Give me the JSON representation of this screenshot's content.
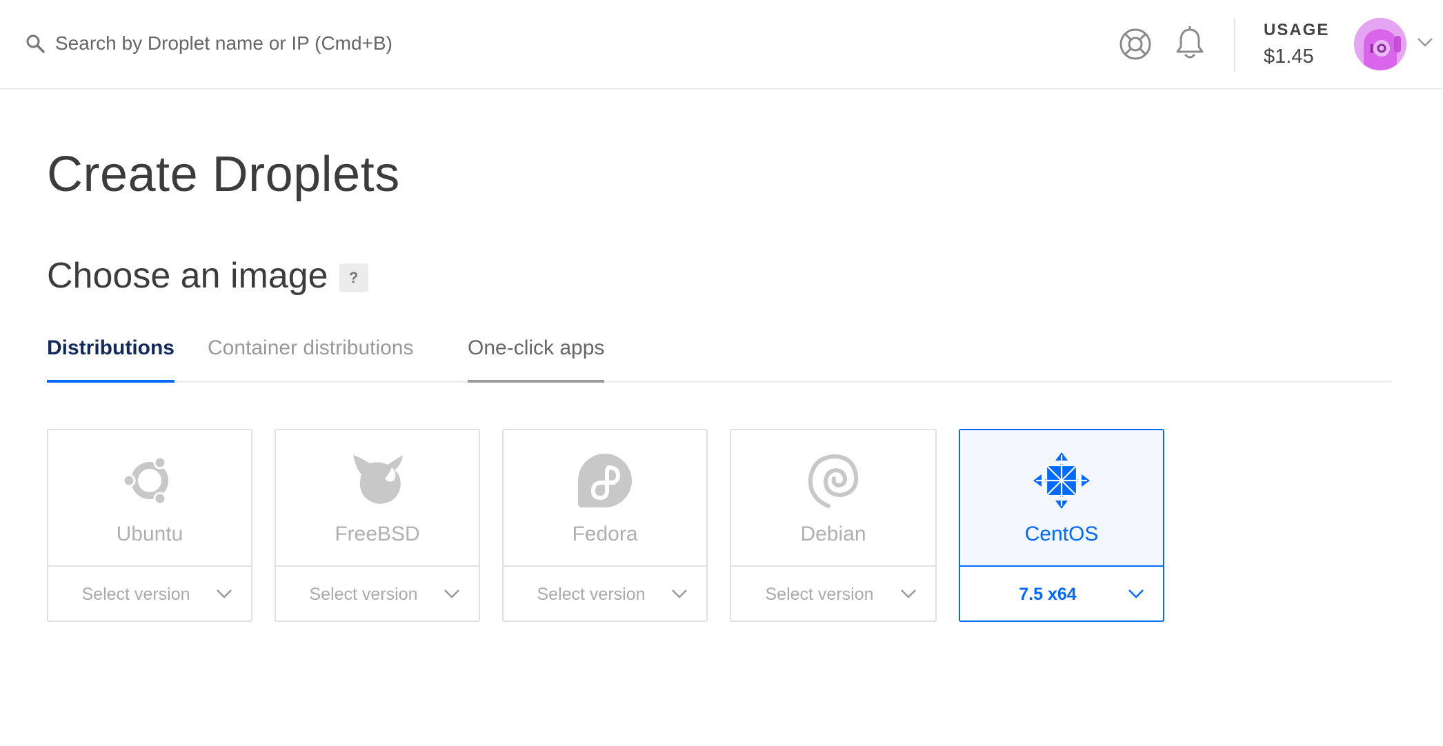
{
  "topbar": {
    "search_placeholder": "Search by Droplet name or IP (Cmd+B)",
    "usage_label": "USAGE",
    "usage_value": "$1.45"
  },
  "main": {
    "page_title": "Create Droplets",
    "section_title": "Choose an image",
    "help_badge": "?",
    "tabs": [
      {
        "label": "Distributions",
        "state": "active"
      },
      {
        "label": "Container distributions",
        "state": "inactive"
      },
      {
        "label": "One-click apps",
        "state": "hover"
      }
    ],
    "distributions": [
      {
        "name": "Ubuntu",
        "icon": "ubuntu-logo-icon",
        "version": "Select version",
        "selected": false
      },
      {
        "name": "FreeBSD",
        "icon": "freebsd-logo-icon",
        "version": "Select version",
        "selected": false
      },
      {
        "name": "Fedora",
        "icon": "fedora-logo-icon",
        "version": "Select version",
        "selected": false
      },
      {
        "name": "Debian",
        "icon": "debian-logo-icon",
        "version": "Select version",
        "selected": false
      },
      {
        "name": "CentOS",
        "icon": "centos-logo-icon",
        "version": "7.5 x64",
        "selected": true
      }
    ]
  },
  "colors": {
    "accent": "#0069ff",
    "active_tab_text": "#12295d",
    "inactive_logo": "#c8c8c8",
    "avatar_bg": "#e6a5f2"
  }
}
